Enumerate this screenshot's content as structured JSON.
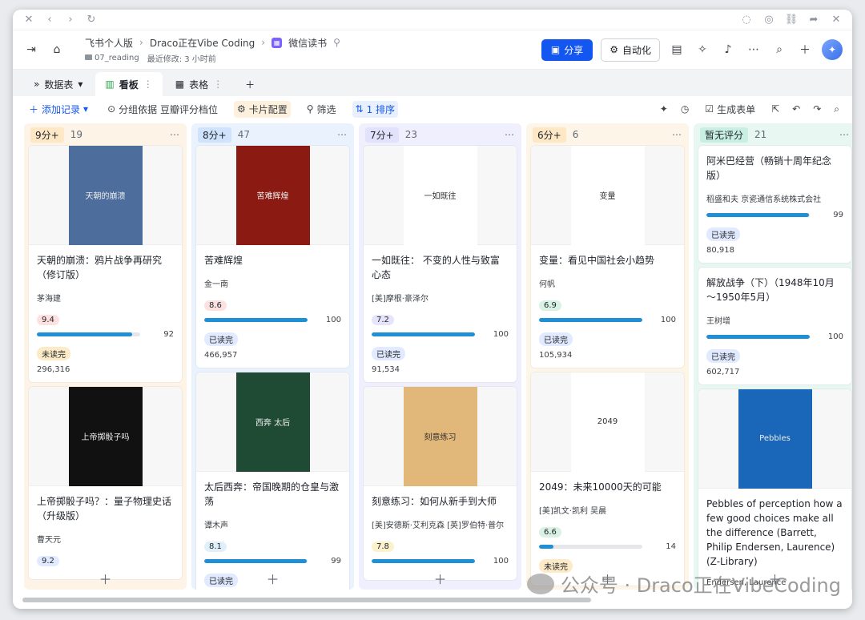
{
  "chrome": {
    "back": "‹",
    "forward": "›",
    "reload": "↻"
  },
  "header": {
    "breadcrumb": [
      "飞书个人版",
      "Draco正在Vibe Coding",
      "微信读书"
    ],
    "folder": "07_reading",
    "modified": "最近修改: 3 小时前",
    "share": "分享",
    "automation": "自动化"
  },
  "tabs": {
    "datasheet": "数据表",
    "board": "看板",
    "table": "表格"
  },
  "toolbar": {
    "add": "添加记录",
    "group": "分组依据 豆瓣评分档位",
    "card": "卡片配置",
    "filter": "筛选",
    "sort": "1 排序",
    "form": "生成表单"
  },
  "columns": [
    {
      "tag": "9分+",
      "count": "19",
      "tag_bg": "#fde7c5",
      "col_bg": "#fdf3e6",
      "cards": [
        {
          "title": "天朝的崩溃：鸦片战争再研究（修订版）",
          "author": "茅海建",
          "score": "9.4",
          "score_bg": "#fde0e0",
          "progress": 92,
          "progress_label": "92",
          "status": "未读完",
          "status_kind": "unread",
          "count": "296,316",
          "cover": "天朝的崩溃",
          "cover_bg": "#4d6e9c"
        },
        {
          "title": "上帝掷骰子吗？：量子物理史话（升级版）",
          "author": "曹天元",
          "score": "9.2",
          "score_bg": "#e1eaff",
          "progress": 0,
          "progress_label": "",
          "status": "",
          "status_kind": "",
          "count": "",
          "cover": "上帝掷骰子吗",
          "cover_bg": "#111111"
        }
      ]
    },
    {
      "tag": "8分+",
      "count": "47",
      "tag_bg": "#cfe3fd",
      "col_bg": "#eaf3fd",
      "cards": [
        {
          "title": "苦难辉煌",
          "author": "金一南",
          "score": "8.6",
          "score_bg": "#fde0e0",
          "progress": 100,
          "progress_label": "100",
          "status": "已读完",
          "status_kind": "read",
          "count": "466,957",
          "cover": "苦难辉煌",
          "cover_bg": "#8a1a12"
        },
        {
          "title": "太后西奔：帝国晚期的仓皇与激荡",
          "author": "谭木声",
          "score": "8.1",
          "score_bg": "#dff0fb",
          "progress": 99,
          "progress_label": "99",
          "status": "已读完",
          "status_kind": "read",
          "count": "",
          "cover": "西奔 太后",
          "cover_bg": "#1f4b35"
        }
      ]
    },
    {
      "tag": "7分+",
      "count": "23",
      "tag_bg": "#e3e2fc",
      "col_bg": "#f0effd",
      "cards": [
        {
          "title": "一如既往： 不变的人性与致富心态",
          "author": "[美]摩根·豪泽尔",
          "score": "7.2",
          "score_bg": "#e6e4fb",
          "progress": 100,
          "progress_label": "100",
          "status": "已读完",
          "status_kind": "read",
          "count": "91,534",
          "cover": "一如既往",
          "cover_bg": "#ffffff"
        },
        {
          "title": "刻意练习：如何从新手到大师",
          "author": "[美]安德斯·艾利克森 [英]罗伯特·普尔",
          "score": "7.8",
          "score_bg": "#fbf2cc",
          "progress": 100,
          "progress_label": "100",
          "status": "",
          "status_kind": "",
          "count": "",
          "cover": "刻意练习",
          "cover_bg": "#e2b77a"
        }
      ]
    },
    {
      "tag": "6分+",
      "count": "6",
      "tag_bg": "#fde7c5",
      "col_bg": "#fdf5e8",
      "cards": [
        {
          "title": "变量：看见中国社会小趋势",
          "author": "何帆",
          "score": "6.9",
          "score_bg": "#d9f2e3",
          "progress": 100,
          "progress_label": "100",
          "status": "已读完",
          "status_kind": "read",
          "count": "105,934",
          "cover": "变量",
          "cover_bg": "#ffffff"
        },
        {
          "title": "2049：未来10000天的可能",
          "author": "[美]凯文·凯利 吴晨",
          "score": "6.6",
          "score_bg": "#d9f2e3",
          "progress": 14,
          "progress_label": "14",
          "status": "未读完",
          "status_kind": "unread",
          "count": "",
          "cover": "2049",
          "cover_bg": "#ffffff"
        }
      ]
    },
    {
      "tag": "暂无评分",
      "count": "21",
      "tag_bg": "#c9efe3",
      "col_bg": "#e8f7f2",
      "cards": [
        {
          "title": "阿米巴经营（畅销十周年纪念版）",
          "author": "稻盛和夫 京瓷通信系统株式会社",
          "score": "",
          "score_bg": "",
          "progress": 99,
          "progress_label": "99",
          "status": "已读完",
          "status_kind": "read",
          "count": "80,918",
          "cover": "",
          "cover_bg": ""
        },
        {
          "title": "解放战争（下）（1948年10月～1950年5月）",
          "author": "王树增",
          "score": "",
          "score_bg": "",
          "progress": 100,
          "progress_label": "100",
          "status": "已读完",
          "status_kind": "read",
          "count": "602,717",
          "cover": "",
          "cover_bg": ""
        },
        {
          "title": "Pebbles of perception  how a few good choices make all the difference (Barrett, Philip Endersen, Laurence) (Z-Library)",
          "author": "Endersen, Laurence",
          "score": "",
          "score_bg": "",
          "progress": 0,
          "progress_label": "",
          "status": "",
          "status_kind": "",
          "count": "",
          "cover": "Pebbles",
          "cover_bg": "#1a66b8"
        }
      ]
    }
  ],
  "watermark": "公众号 · Draco正在VibeCoding"
}
